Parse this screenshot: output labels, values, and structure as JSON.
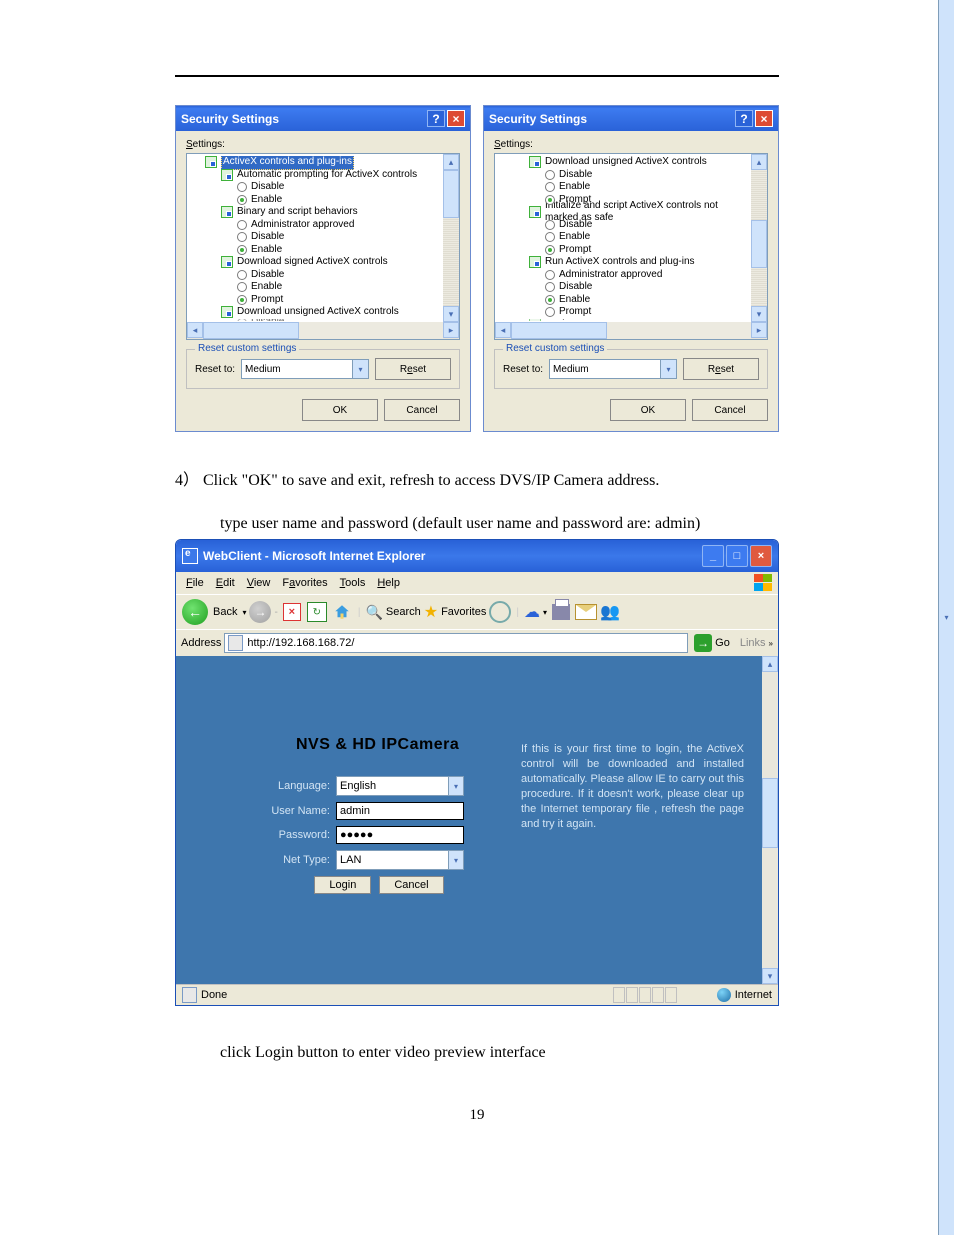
{
  "dialogs": {
    "title": "Security Settings",
    "settings_label": "Settings:",
    "left_tree": [
      {
        "type": "ax",
        "level": 1,
        "text": "ActiveX controls and plug-ins",
        "selected": true
      },
      {
        "type": "ax",
        "level": 2,
        "text": "Automatic prompting for ActiveX controls"
      },
      {
        "type": "radio",
        "level": 3,
        "text": "Disable",
        "sel": false
      },
      {
        "type": "radio",
        "level": 3,
        "text": "Enable",
        "sel": true
      },
      {
        "type": "ax",
        "level": 2,
        "text": "Binary and script behaviors"
      },
      {
        "type": "radio",
        "level": 3,
        "text": "Administrator approved",
        "sel": false
      },
      {
        "type": "radio",
        "level": 3,
        "text": "Disable",
        "sel": false
      },
      {
        "type": "radio",
        "level": 3,
        "text": "Enable",
        "sel": true
      },
      {
        "type": "ax",
        "level": 2,
        "text": "Download signed ActiveX controls"
      },
      {
        "type": "radio",
        "level": 3,
        "text": "Disable",
        "sel": false
      },
      {
        "type": "radio",
        "level": 3,
        "text": "Enable",
        "sel": false
      },
      {
        "type": "radio",
        "level": 3,
        "text": "Prompt",
        "sel": true
      },
      {
        "type": "ax",
        "level": 2,
        "text": "Download unsigned ActiveX controls"
      },
      {
        "type": "radio",
        "level": 3,
        "text": "Disable",
        "sel": false,
        "cut": true
      }
    ],
    "right_tree": [
      {
        "type": "ax",
        "level": 2,
        "text": "Download unsigned ActiveX controls"
      },
      {
        "type": "radio",
        "level": 3,
        "text": "Disable",
        "sel": false
      },
      {
        "type": "radio",
        "level": 3,
        "text": "Enable",
        "sel": false
      },
      {
        "type": "radio",
        "level": 3,
        "text": "Prompt",
        "sel": true
      },
      {
        "type": "ax",
        "level": 2,
        "text": "Initialize and script ActiveX controls not marked as safe"
      },
      {
        "type": "radio",
        "level": 3,
        "text": "Disable",
        "sel": false
      },
      {
        "type": "radio",
        "level": 3,
        "text": "Enable",
        "sel": false
      },
      {
        "type": "radio",
        "level": 3,
        "text": "Prompt",
        "sel": true
      },
      {
        "type": "ax",
        "level": 2,
        "text": "Run ActiveX controls and plug-ins"
      },
      {
        "type": "radio",
        "level": 3,
        "text": "Administrator approved",
        "sel": false
      },
      {
        "type": "radio",
        "level": 3,
        "text": "Disable",
        "sel": false
      },
      {
        "type": "radio",
        "level": 3,
        "text": "Enable",
        "sel": true
      },
      {
        "type": "radio",
        "level": 3,
        "text": "Prompt",
        "sel": false
      },
      {
        "type": "ax",
        "level": 2,
        "text": "Script ActiveX controls marked safe for scripting",
        "cut": true
      }
    ],
    "reset_legend": "Reset custom settings",
    "reset_to_label": "Reset to:",
    "reset_combo": "Medium",
    "reset_btn": "Reset",
    "ok_btn": "OK",
    "cancel_btn": "Cancel"
  },
  "body": {
    "step4": "4） Click \"OK\" to save and exit, refresh to access DVS/IP Camera address.",
    "type_line": "type user name and password (default user name and password are: admin)",
    "click_login": "click Login button to enter video preview interface",
    "page_num": "19"
  },
  "browser": {
    "title": "WebClient - Microsoft Internet Explorer",
    "menus": [
      "File",
      "Edit",
      "View",
      "Favorites",
      "Tools",
      "Help"
    ],
    "back_label": "Back",
    "search_label": "Search",
    "favorites_label": "Favorites",
    "address_label": "Address",
    "url": "http://192.168.168.72/",
    "go_label": "Go",
    "links_label": "Links",
    "camera_title": "NVS & HD IPCamera",
    "form": {
      "language_label": "Language:",
      "language_value": "English",
      "username_label": "User Name:",
      "username_value": "admin",
      "password_label": "Password:",
      "password_value": "●●●●●",
      "nettype_label": "Net Type:",
      "nettype_value": "LAN",
      "login_btn": "Login",
      "cancel_btn": "Cancel"
    },
    "info_text": "If this is your first time to login, the ActiveX control will be downloaded and installed automatically. Please allow IE to carry out this procedure. If it doesn't work, please clear up the Internet temporary file , refresh the page and try it again.",
    "status_done": "Done",
    "status_zone": "Internet"
  }
}
